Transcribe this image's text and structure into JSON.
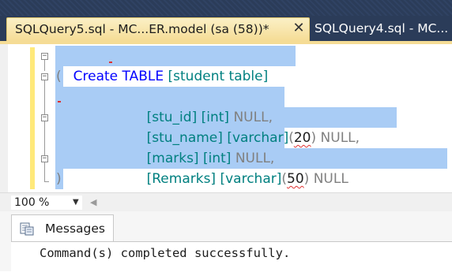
{
  "tabs": {
    "active_label": "SQLQuery5.sql - MC...ER.model (sa (58))*",
    "close_glyph": "✕",
    "inactive_label": "SQLQuery4.sql - MC..."
  },
  "editor": {
    "line1": {
      "kw": "Create",
      "kw2": "TABLE",
      "name": "[student table]"
    },
    "line2": "(",
    "line3": {
      "col": "[stu_id]",
      "type": "[int]",
      "null": "NULL",
      "comma": ","
    },
    "line4": {
      "col": "[stu_name]",
      "type": "[varchar]",
      "lp": "(",
      "num": "20",
      "rp": ")",
      "null": "NULL",
      "comma": ","
    },
    "line5": {
      "col": "[marks]",
      "type": "[int]",
      "null": "NULL",
      "comma": ","
    },
    "line6": {
      "col": "[Remarks]",
      "type": "[varchar]",
      "lp": "(",
      "num": "50",
      "rp": ")",
      "null": "NULL"
    },
    "line7": ")",
    "fold_glyph": "−"
  },
  "statusbar": {
    "zoom": "100 %",
    "zoom_caret": "▼",
    "scroll_left": "◀"
  },
  "results": {
    "tab_label": "Messages",
    "message": "Command(s) completed successfully."
  }
}
